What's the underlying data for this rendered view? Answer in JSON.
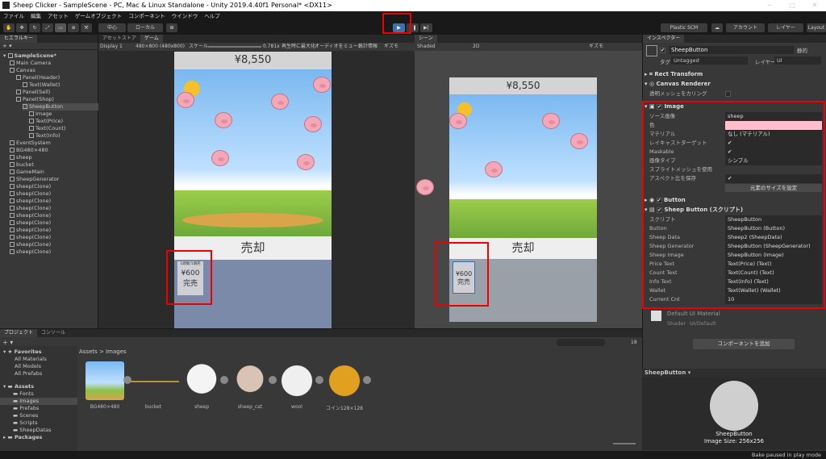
{
  "titlebar": {
    "title": "Sheep Clicker - SampleScene - PC, Mac & Linux Standalone - Unity 2019.4.40f1 Personal* <DX11>"
  },
  "menu": [
    "ファイル",
    "編集",
    "アセット",
    "ゲームオブジェクト",
    "コンポーネント",
    "ウインドウ",
    "ヘルプ"
  ],
  "toolbar": {
    "pivot": "中心",
    "space": "ローカル",
    "plastic": "Plastic SCM",
    "account": "アカウント",
    "layers": "レイヤー",
    "layout": "Layout"
  },
  "hierarchy": {
    "tab": "ヒエラルキー",
    "scene": "SampleScene*",
    "items": [
      {
        "label": "Main Camera",
        "indent": 1
      },
      {
        "label": "Canvas",
        "indent": 1
      },
      {
        "label": "Panel(Header)",
        "indent": 2
      },
      {
        "label": "Text(Wallet)",
        "indent": 3
      },
      {
        "label": "Panel(Sell)",
        "indent": 2
      },
      {
        "label": "Panel(Shop)",
        "indent": 2
      },
      {
        "label": "SheepButton",
        "indent": 3
      },
      {
        "label": "Image",
        "indent": 4
      },
      {
        "label": "Text(Price)",
        "indent": 4
      },
      {
        "label": "Text(Count)",
        "indent": 4
      },
      {
        "label": "Text(Info)",
        "indent": 4
      },
      {
        "label": "EventSystem",
        "indent": 1
      },
      {
        "label": "BG480×480",
        "indent": 1
      },
      {
        "label": "sheep",
        "indent": 1
      },
      {
        "label": "bucket",
        "indent": 1
      },
      {
        "label": "GameMain",
        "indent": 1
      },
      {
        "label": "SheepGenerator",
        "indent": 1
      },
      {
        "label": "sheep(Clone)",
        "indent": 1
      },
      {
        "label": "sheep(Clone)",
        "indent": 1
      },
      {
        "label": "sheep(Clone)",
        "indent": 1
      },
      {
        "label": "sheep(Clone)",
        "indent": 1
      },
      {
        "label": "sheep(Clone)",
        "indent": 1
      },
      {
        "label": "sheep(Clone)",
        "indent": 1
      },
      {
        "label": "sheep(Clone)",
        "indent": 1
      },
      {
        "label": "sheep(Clone)",
        "indent": 1
      },
      {
        "label": "sheep(Clone)",
        "indent": 1
      },
      {
        "label": "sheep(Clone)",
        "indent": 1
      }
    ]
  },
  "game": {
    "tab_asset": "アセットストア",
    "tab_game": "ゲーム",
    "display": "Display 1",
    "resolution": "480×800 (480x800)",
    "scale_label": "スケール",
    "scale_value": "0.781x",
    "maximize": "再生時に最大化",
    "mute": "オーディオをミュート",
    "stats": "統計情報",
    "gizmos": "ギズモ",
    "wallet": "¥8,550",
    "sell": "売却",
    "shop_top": "1頭販/1頭売",
    "shop_price": "¥600",
    "shop_status": "完売"
  },
  "scene": {
    "tab": "シーン",
    "shading": "Shaded",
    "mode": "2D",
    "gizmos": "ギズモ",
    "wallet": "¥8,550",
    "sell": "売却",
    "shop_price": "¥600",
    "shop_status": "完売"
  },
  "inspector": {
    "tab": "インスペクター",
    "object_name": "SheepButton",
    "static": "静的",
    "tag_label": "タグ",
    "tag": "Untagged",
    "layer_label": "レイヤー",
    "layer": "UI",
    "rect_transform": "Rect Transform",
    "canvas_renderer": "Canvas Renderer",
    "cull_label": "透明メッシュをカリング",
    "image": {
      "title": "Image",
      "rows": [
        {
          "label": "ソース画像",
          "value": "sheep"
        },
        {
          "label": "色",
          "value": ""
        },
        {
          "label": "マテリアル",
          "value": "なし (マテリアル)"
        },
        {
          "label": "レイキャストターゲット",
          "value": "✔"
        },
        {
          "label": "Maskable",
          "value": "✔"
        },
        {
          "label": "画像タイプ",
          "value": "シンプル"
        },
        {
          "label": "スプライトメッシュを使用",
          "value": ""
        },
        {
          "label": "アスペクト比を保存",
          "value": "✔"
        }
      ],
      "native_size": "元素のサイズを設定"
    },
    "button": "Button",
    "script": {
      "title": "Sheep Button (スクリプト)",
      "rows": [
        {
          "label": "スクリプト",
          "value": "SheepButton"
        },
        {
          "label": "Button",
          "value": "SheepButton (Button)"
        },
        {
          "label": "Sheep Data",
          "value": "Sheep2 (SheepData)"
        },
        {
          "label": "Sheep Generator",
          "value": "SheepButton (SheepGenerator)"
        },
        {
          "label": "Sheep Image",
          "value": "SheepButton (Image)"
        },
        {
          "label": "Price Text",
          "value": "Text(Price) (Text)"
        },
        {
          "label": "Count Text",
          "value": "Text(Count) (Text)"
        },
        {
          "label": "Info Text",
          "value": "Text(Info) (Text)"
        },
        {
          "label": "Wallet",
          "value": "Text(Wallet) (Wallet)"
        },
        {
          "label": "Current Cnt",
          "value": "10"
        }
      ]
    },
    "material": "Default UI Material",
    "shader_label": "Shader",
    "shader": "UI/Default",
    "add_component": "コンポーネントを追加",
    "preview_name": "SheepButton",
    "preview_caption": "SheepButton",
    "preview_size": "Image Size: 256x256"
  },
  "project": {
    "tab_project": "プロジェクト",
    "tab_console": "コンソール",
    "favorites": "Favorites",
    "fav_items": [
      "All Materials",
      "All Models",
      "All Prefabs"
    ],
    "assets": "Assets",
    "asset_folders": [
      "Fonts",
      "Images",
      "Prefabs",
      "Scenes",
      "Scripts",
      "SheepDatas"
    ],
    "packages": "Packages",
    "breadcrumb": "Assets > Images",
    "count": "18",
    "assets_list": [
      "BG480×480",
      "bucket",
      "sheep",
      "sheep_cat",
      "wool",
      "コイン128×128"
    ]
  },
  "status": {
    "text": "Bake paused in play mode"
  },
  "colors": {
    "accent": "#3a72b0",
    "highlight": "#e00000"
  }
}
